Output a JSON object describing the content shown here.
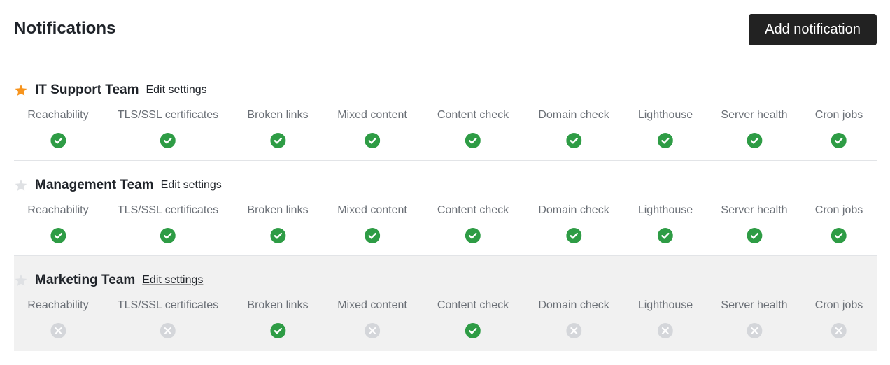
{
  "header": {
    "title": "Notifications",
    "add_button": "Add notification"
  },
  "colors": {
    "star_active": "#f7941d",
    "star_inactive": "#dfe1e4",
    "ok": "#2e9c45",
    "off": "#d4d6da"
  },
  "groups": [
    {
      "name": "IT Support Team",
      "starred": true,
      "edit_label": "Edit settings",
      "checks": [
        {
          "label": "Reachability",
          "enabled": true
        },
        {
          "label": "TLS/SSL certificates",
          "enabled": true
        },
        {
          "label": "Broken links",
          "enabled": true
        },
        {
          "label": "Mixed content",
          "enabled": true
        },
        {
          "label": "Content check",
          "enabled": true
        },
        {
          "label": "Domain check",
          "enabled": true
        },
        {
          "label": "Lighthouse",
          "enabled": true
        },
        {
          "label": "Server health",
          "enabled": true
        },
        {
          "label": "Cron jobs",
          "enabled": true
        }
      ]
    },
    {
      "name": "Management Team",
      "starred": false,
      "edit_label": "Edit settings",
      "checks": [
        {
          "label": "Reachability",
          "enabled": true
        },
        {
          "label": "TLS/SSL certificates",
          "enabled": true
        },
        {
          "label": "Broken links",
          "enabled": true
        },
        {
          "label": "Mixed content",
          "enabled": true
        },
        {
          "label": "Content check",
          "enabled": true
        },
        {
          "label": "Domain check",
          "enabled": true
        },
        {
          "label": "Lighthouse",
          "enabled": true
        },
        {
          "label": "Server health",
          "enabled": true
        },
        {
          "label": "Cron jobs",
          "enabled": true
        }
      ]
    },
    {
      "name": "Marketing Team",
      "starred": false,
      "edit_label": "Edit settings",
      "checks": [
        {
          "label": "Reachability",
          "enabled": false
        },
        {
          "label": "TLS/SSL certificates",
          "enabled": false
        },
        {
          "label": "Broken links",
          "enabled": true
        },
        {
          "label": "Mixed content",
          "enabled": false
        },
        {
          "label": "Content check",
          "enabled": true
        },
        {
          "label": "Domain check",
          "enabled": false
        },
        {
          "label": "Lighthouse",
          "enabled": false
        },
        {
          "label": "Server health",
          "enabled": false
        },
        {
          "label": "Cron jobs",
          "enabled": false
        }
      ]
    }
  ]
}
